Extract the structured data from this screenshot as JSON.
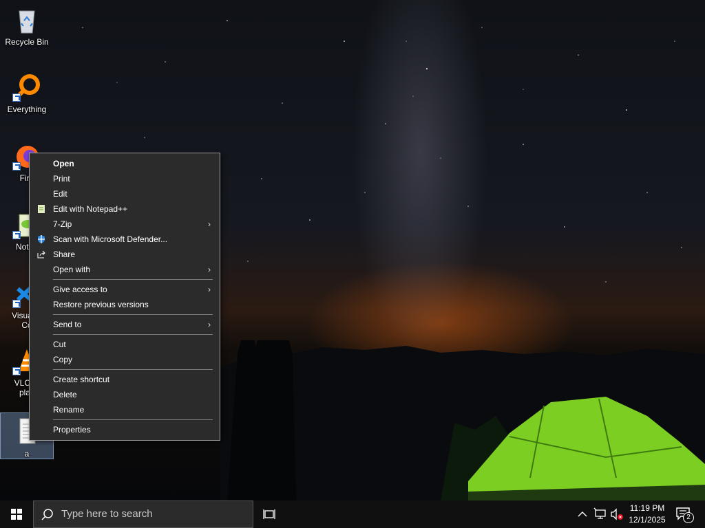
{
  "desktop": {
    "icons": [
      {
        "label": "Recycle Bin"
      },
      {
        "label": "Everything"
      },
      {
        "label": "Fire"
      },
      {
        "label": "Notep"
      },
      {
        "label_line1": "Visual S",
        "label_line2": "Co"
      },
      {
        "label_line1": "VLC m",
        "label_line2": "play"
      },
      {
        "label": "a"
      }
    ]
  },
  "context_menu": {
    "items": [
      {
        "label": "Open"
      },
      {
        "label": "Print"
      },
      {
        "label": "Edit"
      },
      {
        "label": "Edit with Notepad++",
        "icon": "notepadpp-icon"
      },
      {
        "label": "7-Zip"
      },
      {
        "label": "Scan with Microsoft Defender...",
        "icon": "defender-shield-icon"
      },
      {
        "label": "Share",
        "icon": "share-icon"
      },
      {
        "label": "Open with"
      },
      {
        "label": "Give access to"
      },
      {
        "label": "Restore previous versions"
      },
      {
        "label": "Send to"
      },
      {
        "label": "Cut"
      },
      {
        "label": "Copy"
      },
      {
        "label": "Create shortcut"
      },
      {
        "label": "Delete"
      },
      {
        "label": "Rename"
      },
      {
        "label": "Properties"
      }
    ],
    "submenu_arrow": "›"
  },
  "taskbar": {
    "search_placeholder": "Type here to search",
    "clock": {
      "time": "11:19 PM",
      "date": "12/1/2025"
    },
    "notification_count": "2"
  },
  "colors": {
    "menu_bg": "#2b2b2b",
    "taskbar_bg": "#101010",
    "tent_green": "#8fe02a",
    "horizon_orange": "#c85a14"
  }
}
